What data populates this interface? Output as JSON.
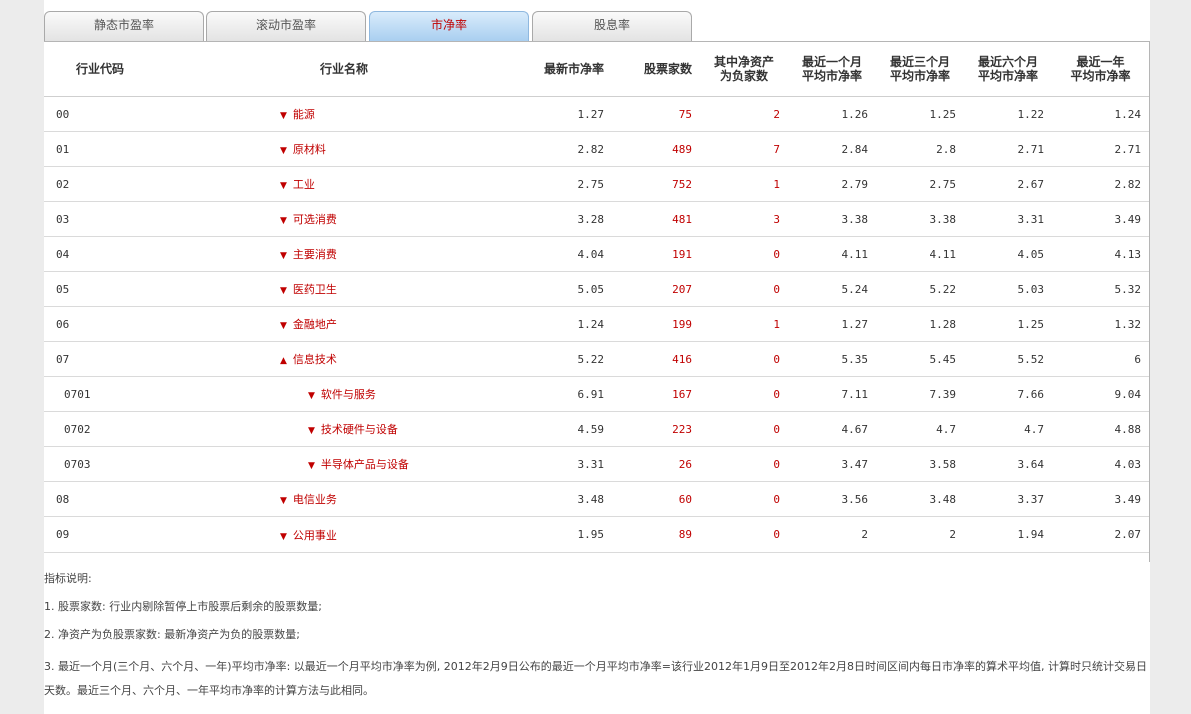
{
  "tabs": [
    {
      "label": "静态市盈率",
      "active": false
    },
    {
      "label": "滚动市盈率",
      "active": false
    },
    {
      "label": "市净率",
      "active": true
    },
    {
      "label": "股息率",
      "active": false
    }
  ],
  "columns": [
    "行业代码",
    "行业名称",
    "最新市净率",
    "股票家数",
    "其中净资产\n为负家数",
    "最近一个月\n平均市净率",
    "最近三个月\n平均市净率",
    "最近六个月\n平均市净率",
    "最近一年\n平均市净率"
  ],
  "rows": [
    {
      "code": "00",
      "name": "能源",
      "arrow": "▼",
      "level": 1,
      "pb": "1.27",
      "count": "75",
      "neg": "2",
      "m1": "1.26",
      "m3": "1.25",
      "m6": "1.22",
      "y1": "1.24"
    },
    {
      "code": "01",
      "name": "原材料",
      "arrow": "▼",
      "level": 1,
      "pb": "2.82",
      "count": "489",
      "neg": "7",
      "m1": "2.84",
      "m3": "2.8",
      "m6": "2.71",
      "y1": "2.71"
    },
    {
      "code": "02",
      "name": "工业",
      "arrow": "▼",
      "level": 1,
      "pb": "2.75",
      "count": "752",
      "neg": "1",
      "m1": "2.79",
      "m3": "2.75",
      "m6": "2.67",
      "y1": "2.82"
    },
    {
      "code": "03",
      "name": "可选消费",
      "arrow": "▼",
      "level": 1,
      "pb": "3.28",
      "count": "481",
      "neg": "3",
      "m1": "3.38",
      "m3": "3.38",
      "m6": "3.31",
      "y1": "3.49"
    },
    {
      "code": "04",
      "name": "主要消费",
      "arrow": "▼",
      "level": 1,
      "pb": "4.04",
      "count": "191",
      "neg": "0",
      "m1": "4.11",
      "m3": "4.11",
      "m6": "4.05",
      "y1": "4.13"
    },
    {
      "code": "05",
      "name": "医药卫生",
      "arrow": "▼",
      "level": 1,
      "pb": "5.05",
      "count": "207",
      "neg": "0",
      "m1": "5.24",
      "m3": "5.22",
      "m6": "5.03",
      "y1": "5.32"
    },
    {
      "code": "06",
      "name": "金融地产",
      "arrow": "▼",
      "level": 1,
      "pb": "1.24",
      "count": "199",
      "neg": "1",
      "m1": "1.27",
      "m3": "1.28",
      "m6": "1.25",
      "y1": "1.32"
    },
    {
      "code": "07",
      "name": "信息技术",
      "arrow": "▲",
      "level": 1,
      "pb": "5.22",
      "count": "416",
      "neg": "0",
      "m1": "5.35",
      "m3": "5.45",
      "m6": "5.52",
      "y1": "6"
    },
    {
      "code": "0701",
      "name": "软件与服务",
      "arrow": "▼",
      "level": 2,
      "pb": "6.91",
      "count": "167",
      "neg": "0",
      "m1": "7.11",
      "m3": "7.39",
      "m6": "7.66",
      "y1": "9.04"
    },
    {
      "code": "0702",
      "name": "技术硬件与设备",
      "arrow": "▼",
      "level": 2,
      "pb": "4.59",
      "count": "223",
      "neg": "0",
      "m1": "4.67",
      "m3": "4.7",
      "m6": "4.7",
      "y1": "4.88"
    },
    {
      "code": "0703",
      "name": "半导体产品与设备",
      "arrow": "▼",
      "level": 2,
      "pb": "3.31",
      "count": "26",
      "neg": "0",
      "m1": "3.47",
      "m3": "3.58",
      "m6": "3.64",
      "y1": "4.03"
    },
    {
      "code": "08",
      "name": "电信业务",
      "arrow": "▼",
      "level": 1,
      "pb": "3.48",
      "count": "60",
      "neg": "0",
      "m1": "3.56",
      "m3": "3.48",
      "m6": "3.37",
      "y1": "3.49"
    },
    {
      "code": "09",
      "name": "公用事业",
      "arrow": "▼",
      "level": 1,
      "pb": "1.95",
      "count": "89",
      "neg": "0",
      "m1": "2",
      "m3": "2",
      "m6": "1.94",
      "y1": "2.07"
    }
  ],
  "notes": {
    "title": "指标说明:",
    "items": [
      "1. 股票家数: 行业内剔除暂停上市股票后剩余的股票数量;",
      "2. 净资产为负股票家数: 最新净资产为负的股票数量;",
      "3. 最近一个月(三个月、六个月、一年)平均市净率: 以最近一个月平均市净率为例, 2012年2月9日公布的最近一个月平均市净率=该行业2012年1月9日至2012年2月8日时间区间内每日市净率的算术平均值, 计算时只统计交易日天数。最近三个月、六个月、一年平均市净率的计算方法与此相同。"
    ]
  },
  "colors": {
    "accent": "#c00000",
    "tab_active": "#a9cff0"
  }
}
